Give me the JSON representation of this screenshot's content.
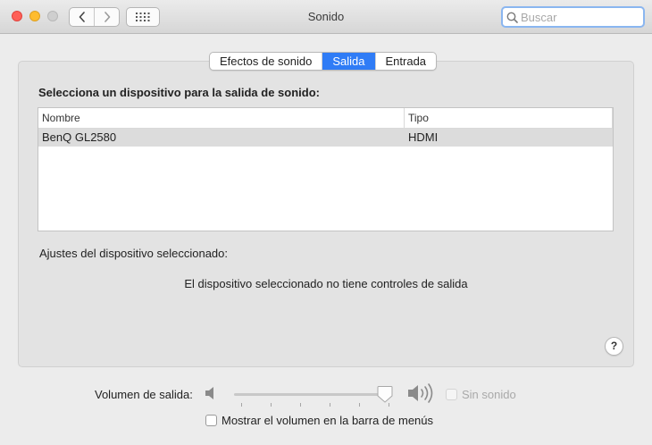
{
  "window": {
    "title": "Sonido"
  },
  "search": {
    "placeholder": "Buscar",
    "value": ""
  },
  "tabs": [
    {
      "label": "Efectos de sonido",
      "active": false
    },
    {
      "label": "Salida",
      "active": true
    },
    {
      "label": "Entrada",
      "active": false
    }
  ],
  "output": {
    "heading": "Selecciona un dispositivo para la salida de sonido:",
    "columns": {
      "name": "Nombre",
      "type": "Tipo"
    },
    "rows": [
      {
        "name": "BenQ GL2580",
        "type": "HDMI",
        "selected": true
      }
    ],
    "settings_label": "Ajustes del dispositivo seleccionado:",
    "no_controls": "El dispositivo seleccionado no tiene controles de salida"
  },
  "help": {
    "label": "?"
  },
  "volume": {
    "label": "Volumen de salida:",
    "level_fraction": 0.96,
    "mute_label": "Sin sonido",
    "mute_checked": false,
    "mute_enabled": false,
    "show_in_menubar_label": "Mostrar el volumen en la barra de menús",
    "show_in_menubar_checked": false
  },
  "icons": {
    "back": "chevron-left-icon",
    "forward": "chevron-right-icon",
    "grid": "grid-icon",
    "search": "search-icon",
    "speaker_low": "speaker-low-icon",
    "speaker_high": "speaker-high-icon",
    "help": "help-icon"
  },
  "colors": {
    "accent": "#2f7cf6",
    "close": "#fe5f57",
    "minimize": "#febc2e",
    "zoom_disabled": "#cfcfcf"
  }
}
